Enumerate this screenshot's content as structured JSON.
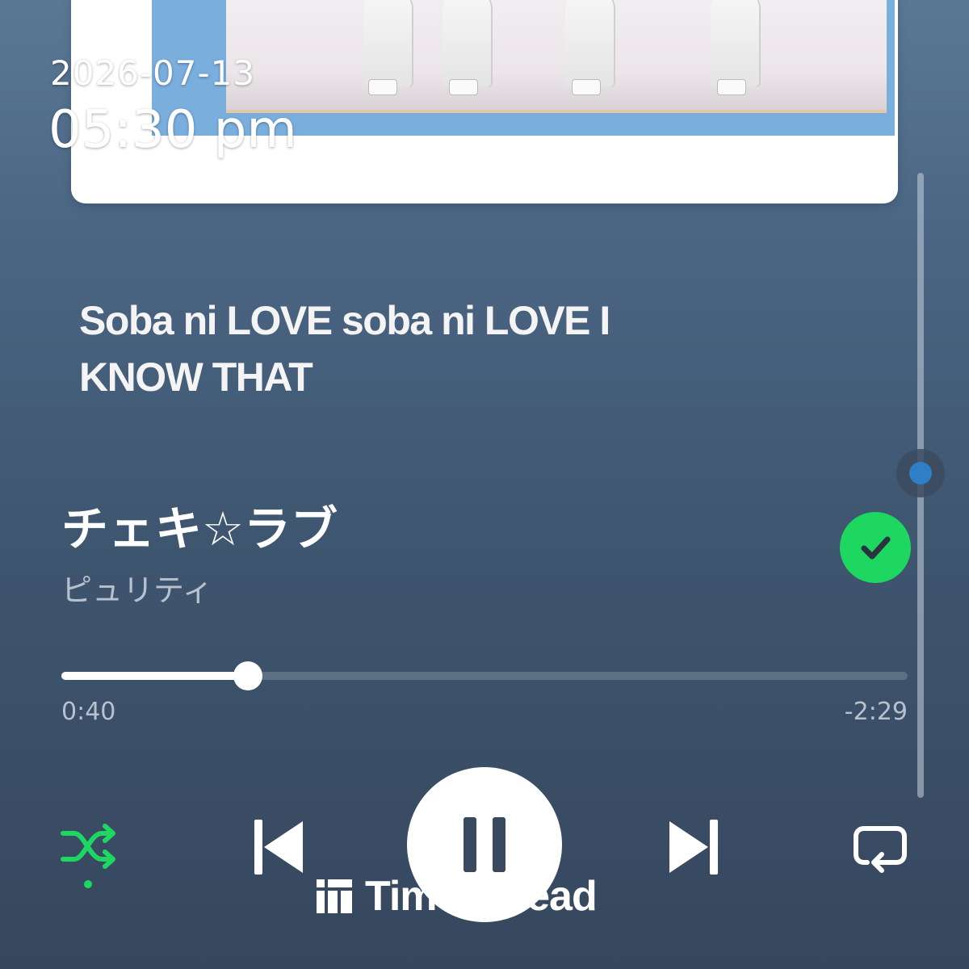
{
  "status": {
    "date": "2026-07-13",
    "time": "05:30 pm"
  },
  "lyrics": {
    "current_line": "Soba ni LOVE soba ni LOVE I KNOW THAT"
  },
  "track": {
    "title": "チェキ☆ラブ",
    "artist": "ピュリティ",
    "liked": true
  },
  "playback": {
    "elapsed": "0:40",
    "remaining": "-2:29",
    "progress_fraction": 0.22,
    "is_playing": true,
    "shuffle_on": true,
    "repeat_on": false
  },
  "lyrics_scroll": {
    "position_fraction": 0.48
  },
  "watermark": {
    "brand": "TimeSpread"
  },
  "colors": {
    "accent": "#1ed760",
    "background_top": "#5a7896",
    "background_bottom": "#36475d",
    "album_blue": "#7aaedd",
    "scroll_thumb": "#2f7fc8"
  },
  "icons": {
    "liked": "check-circle-icon",
    "shuffle": "shuffle-icon",
    "previous": "skip-previous-icon",
    "pause": "pause-icon",
    "next": "skip-next-icon",
    "repeat": "repeat-icon",
    "watermark": "timespread-logo-icon"
  }
}
